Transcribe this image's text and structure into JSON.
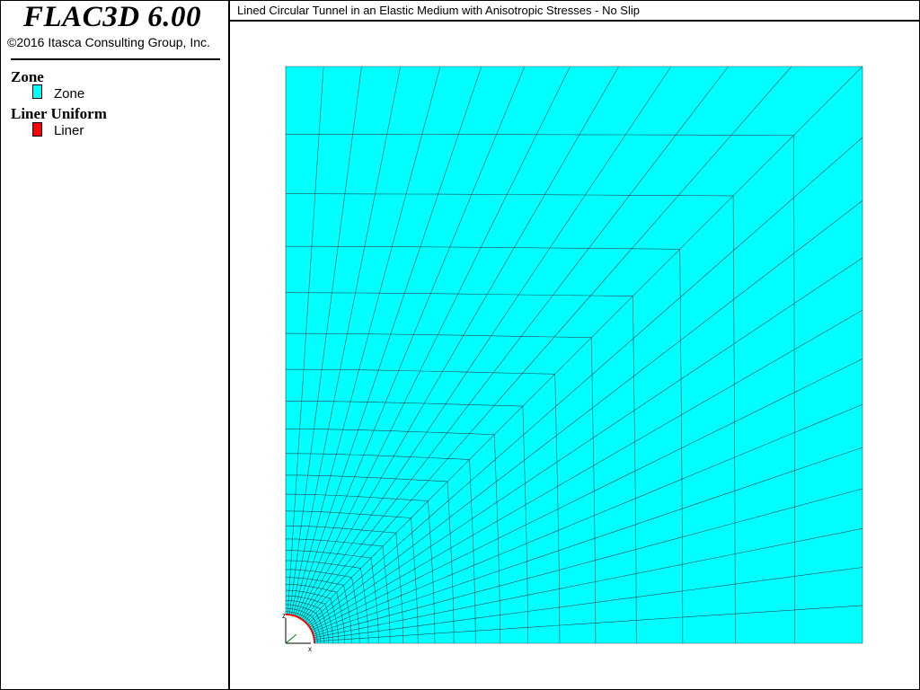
{
  "app": {
    "title": "FLAC3D 6.00",
    "copyright": "©2016 Itasca Consulting Group, Inc."
  },
  "plot": {
    "title": "Lined Circular Tunnel in an Elastic Medium with Anisotropic Stresses - No Slip"
  },
  "legend": {
    "zone": {
      "heading": "Zone",
      "label": "Zone",
      "color": "#00ffff"
    },
    "liner": {
      "heading": "Liner Uniform",
      "label": "Liner",
      "color": "#ff0000"
    }
  },
  "model": {
    "zone_color": "#00ffff",
    "line_color": "#205058",
    "liner_color": "#ff0000",
    "axes": {
      "x": "x",
      "z": "z"
    }
  }
}
